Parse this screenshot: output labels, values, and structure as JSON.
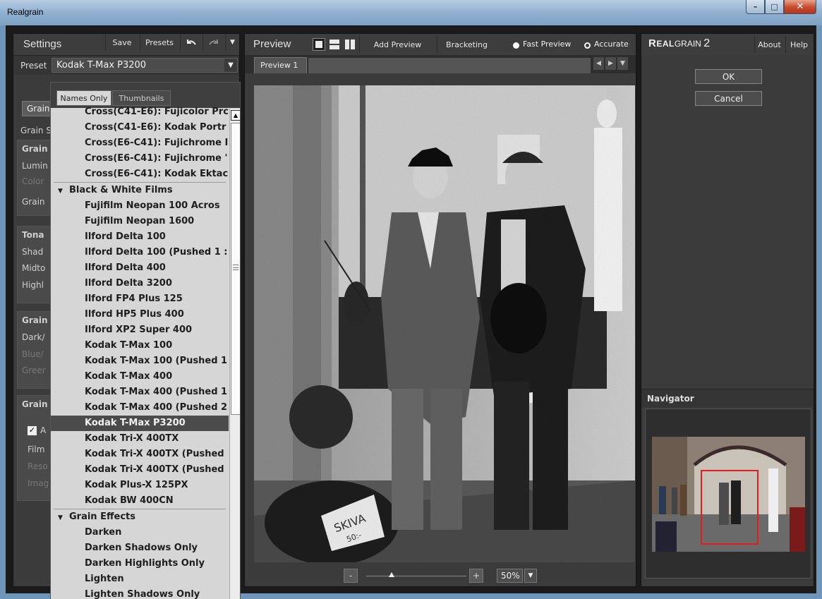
{
  "window": {
    "title": "Realgrain",
    "min": "–",
    "max": "□",
    "close": "✕"
  },
  "settings": {
    "title": "Settings",
    "buttons": {
      "save": "Save",
      "presets": "Presets",
      "undo_icon": "undo-icon",
      "redo_icon": "redo-icon",
      "menu_icon": "chevron-down-icon"
    },
    "preset_label": "Preset",
    "preset_value": "Kodak T-Max P3200",
    "hidden_stubs": {
      "grain_tab": "Grain",
      "grain_s": "Grain S",
      "grain1": "Grain",
      "luminance": "Lumin",
      "color": "Color",
      "grain2": "Grain",
      "tonal": "Tona",
      "shadows": "Shad",
      "midtones": "Midto",
      "highlights": "Highl",
      "grain3": "Grain",
      "dark": "Dark/",
      "blue": "Blue/",
      "green": "Greer",
      "grain4": "Grain",
      "chk_label": "A",
      "film": "Film",
      "reso": "Reso",
      "image": "Imag"
    }
  },
  "preset_dropdown": {
    "view_names": "Names Only",
    "view_thumbs": "Thumbnails",
    "items": [
      {
        "kind": "item",
        "label": "Cross(C41-E6): Fujicolor Prc"
      },
      {
        "kind": "item",
        "label": "Cross(C41-E6): Kodak Portr"
      },
      {
        "kind": "item",
        "label": "Cross(E6-C41): Fujichrome I"
      },
      {
        "kind": "item",
        "label": "Cross(E6-C41): Fujichrome '"
      },
      {
        "kind": "item",
        "label": "Cross(E6-C41): Kodak Ektac"
      },
      {
        "kind": "sep"
      },
      {
        "kind": "cat",
        "label": "Black & White Films"
      },
      {
        "kind": "item",
        "label": "Fujifilm Neopan 100 Acros"
      },
      {
        "kind": "item",
        "label": "Fujifilm Neopan 1600"
      },
      {
        "kind": "item",
        "label": "Ilford Delta 100"
      },
      {
        "kind": "item",
        "label": "Ilford Delta 100 (Pushed 1 :"
      },
      {
        "kind": "item",
        "label": "Ilford Delta 400"
      },
      {
        "kind": "item",
        "label": "Ilford Delta 3200"
      },
      {
        "kind": "item",
        "label": "Ilford FP4 Plus 125"
      },
      {
        "kind": "item",
        "label": "Ilford HP5 Plus 400"
      },
      {
        "kind": "item",
        "label": "Ilford XP2 Super 400"
      },
      {
        "kind": "item",
        "label": "Kodak T-Max 100"
      },
      {
        "kind": "item",
        "label": "Kodak T-Max 100 (Pushed 1"
      },
      {
        "kind": "item",
        "label": "Kodak T-Max 400"
      },
      {
        "kind": "item",
        "label": "Kodak T-Max 400 (Pushed 1"
      },
      {
        "kind": "item",
        "label": "Kodak T-Max 400 (Pushed 2"
      },
      {
        "kind": "item",
        "label": "Kodak T-Max P3200",
        "selected": true
      },
      {
        "kind": "item",
        "label": "Kodak Tri-X 400TX"
      },
      {
        "kind": "item",
        "label": "Kodak Tri-X 400TX (Pushed"
      },
      {
        "kind": "item",
        "label": "Kodak Tri-X 400TX (Pushed"
      },
      {
        "kind": "item",
        "label": "Kodak Plus-X 125PX"
      },
      {
        "kind": "item",
        "label": "Kodak BW 400CN"
      },
      {
        "kind": "sep"
      },
      {
        "kind": "cat",
        "label": "Grain Effects"
      },
      {
        "kind": "item",
        "label": "Darken"
      },
      {
        "kind": "item",
        "label": "Darken Shadows Only"
      },
      {
        "kind": "item",
        "label": "Darken Highlights Only"
      },
      {
        "kind": "item",
        "label": "Lighten"
      },
      {
        "kind": "item",
        "label": "Lighten Shadows Only"
      }
    ]
  },
  "preview": {
    "title": "Preview",
    "add_preview": "Add Preview",
    "bracketing": "Bracketing",
    "fast_preview": "Fast Preview",
    "accurate": "Accurate",
    "selected_mode": "accurate",
    "tab": "Preview 1",
    "zoom": "50%",
    "zoom_level": 0.25,
    "minus": "-",
    "plus": "+",
    "photo_text": {
      "sign": "SKIVA",
      "sign2": "50:-"
    }
  },
  "right": {
    "logo_big": "R",
    "logo_rest": "EAL",
    "logo_grain": "GRAIN",
    "logo_version": "2",
    "about": "About",
    "help": "Help",
    "ok": "OK",
    "cancel": "Cancel",
    "navigator": "Navigator"
  },
  "colors": {
    "panel": "#3b3b3b",
    "dropdown_bg": "#d6d6d6",
    "selected_row": "#4b4b4b",
    "nav_rect": "#e01e1e"
  }
}
